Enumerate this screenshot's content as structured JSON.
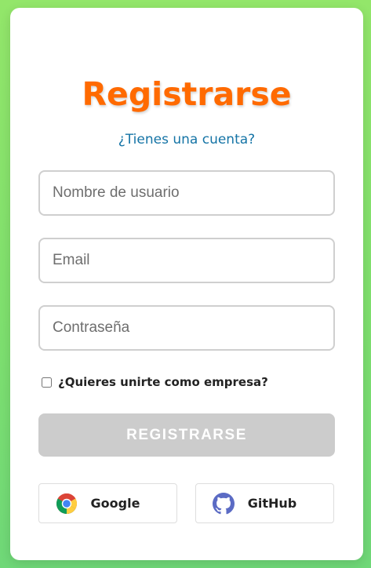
{
  "form": {
    "title": "Registrarse",
    "login_link": "¿Tienes una cuenta?",
    "username_placeholder": "Nombre de usuario",
    "email_placeholder": "Email",
    "password_placeholder": "Contraseña",
    "company_checkbox_label": "¿Quieres unirte como empresa?",
    "company_checkbox_checked": false,
    "submit_label": "REGISTRARSE"
  },
  "social": {
    "google_label": "Google",
    "github_label": "GitHub"
  },
  "colors": {
    "title": "#ff6a00",
    "link": "#1574a6",
    "submit_disabled_bg": "#cccccc",
    "background_gradient_top": "#93e66a",
    "background_gradient_bottom": "#6fd878"
  },
  "icons": {
    "google": "google-chrome-icon",
    "github": "github-icon"
  }
}
